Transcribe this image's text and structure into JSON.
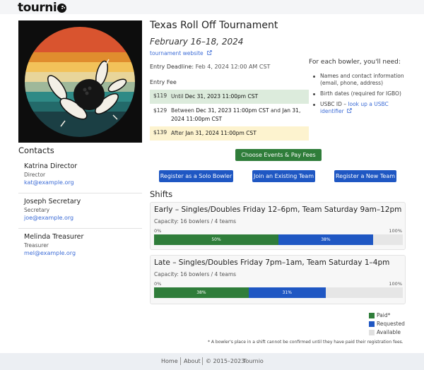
{
  "brand": {
    "name": "tourni",
    "icon": "bowling-ball-icon"
  },
  "tournament": {
    "title": "Texas Roll Off Tournament",
    "dates": "February 16–18, 2024",
    "website_label": "tournament website",
    "deadline_label": "Entry Deadline:",
    "deadline_value": "Feb 4, 2024 12:00 AM CST"
  },
  "fees": {
    "heading": "Entry Fee",
    "rows": [
      {
        "amount": "$119",
        "prefix": "Until",
        "when": "Dec 31, 2023 11:00pm CST",
        "color": "#dcebdc"
      },
      {
        "amount": "$129",
        "prefix": "Between",
        "when": "Dec 31, 2023 11:00pm CST",
        "mid": "and",
        "when2": "Jan 31, 2024 11:00pm CST",
        "color": "#ffffff"
      },
      {
        "amount": "$139",
        "prefix": "After",
        "when": "Jan 31, 2024 11:00pm CST",
        "color": "#fdf3cf"
      }
    ]
  },
  "needs": {
    "heading": "For each bowler, you'll need:",
    "items": [
      {
        "text": "Names and contact information (email, phone, address)"
      },
      {
        "text": "Birth dates (required for IGBO)"
      },
      {
        "text": "USBC ID –",
        "link": "look up a USBC identifier"
      }
    ]
  },
  "actions": {
    "choose": "Choose Events & Pay Fees",
    "solo": "Register as a Solo Bowler",
    "join": "Join an Existing Team",
    "new_team": "Register a New Team"
  },
  "contacts": {
    "heading": "Contacts",
    "people": [
      {
        "name": "Katrina Director",
        "role": "Director",
        "email": "kat@example.org"
      },
      {
        "name": "Joseph Secretary",
        "role": "Secretary",
        "email": "joe@example.org"
      },
      {
        "name": "Melinda Treasurer",
        "role": "Treasurer",
        "email": "mel@example.org"
      }
    ]
  },
  "shifts": {
    "heading": "Shifts",
    "items": [
      {
        "title": "Early – Singles/Doubles Friday 12–6pm, Team Saturday 9am–12pm",
        "capacity": "Capacity: 16 bowlers / 4 teams",
        "paid": 50,
        "requested": 38
      },
      {
        "title": "Late – Singles/Doubles Friday 7pm–1am, Team Saturday 1–4pm",
        "capacity": "Capacity: 16 bowlers / 4 teams",
        "paid": 38,
        "requested": 31
      }
    ],
    "min_label": "0%",
    "max_label": "100%"
  },
  "legend": [
    {
      "label": "Paid*",
      "color": "#2f7d3a"
    },
    {
      "label": "Requested",
      "color": "#1f57c3"
    },
    {
      "label": "Available",
      "color": "#e0e0e0"
    }
  ],
  "footnote": "* A bowler's place in a shift cannot be confirmed until they have paid their registration fees.",
  "footer": {
    "home": "Home",
    "about": "About",
    "copyright": "© 2015–2023",
    "brand_link": "Tournio"
  }
}
